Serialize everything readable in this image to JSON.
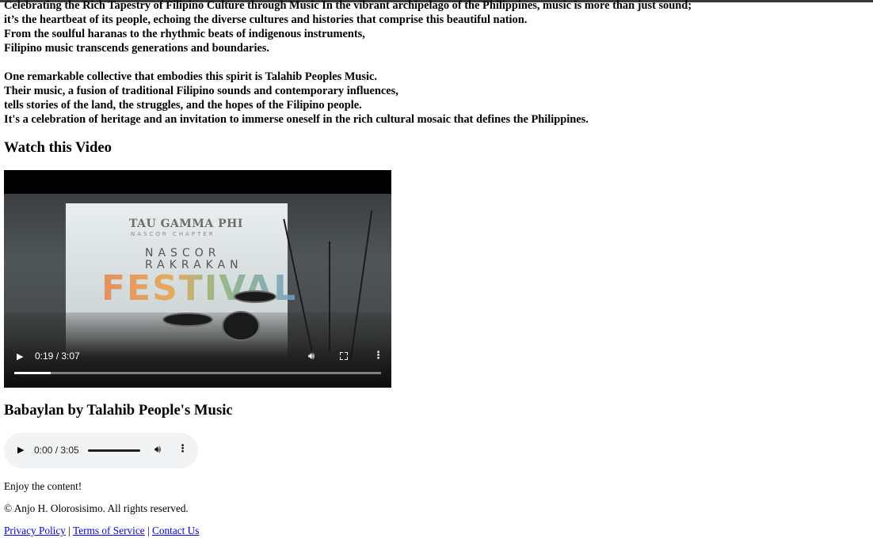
{
  "intro": {
    "lines": [
      "Celebrating the Rich Tapestry of Filipino Culture through Music In the vibrant archipelago of the Philippines, music is more than just sound;",
      "it’s the heartbeat of its people, echoing the diverse cultures and histories that comprise this beautiful nation.",
      "From the soulful haranas to the rhythmic beats of indigenous instruments,",
      "Filipino music transcends generations and boundaries.",
      "One remarkable collective that embodies this spirit is Talahib Peoples Music.",
      "Their music, a fusion of traditional Filipino sounds and contemporary influences,",
      "tells stories of the land, the struggles, and the hopes of the Filipino people.",
      "It's a celebration of heritage and an invitation to immerse oneself in the rich cultural mosaic that defines the Philippines."
    ]
  },
  "video_section": {
    "heading": "Watch this Video",
    "player": {
      "time_display": "0:19 / 3:07",
      "progress_fraction": 0.1,
      "frame_text": {
        "banner_line1": "TAU GAMMA PHI",
        "banner_line2": "NASCOR CHAPTER",
        "banner_line3a": "NASCOR",
        "banner_line3b": "RAKRAKAN",
        "banner_line4": "FESTIVAL"
      },
      "icons": {
        "play": "play-icon",
        "volume": "volume-icon",
        "fullscreen": "fullscreen-icon",
        "more": "more-options-icon"
      }
    }
  },
  "audio_section": {
    "heading": "Babaylan by Talahib People's Music",
    "player": {
      "time_display": "0:00 / 3:05",
      "icons": {
        "play": "play-icon",
        "volume": "volume-icon",
        "more": "more-options-icon"
      }
    }
  },
  "footer": {
    "message": "Enjoy the content!",
    "copyright": "© Anjo H. Olorosisimo. All rights reserved.",
    "links": {
      "privacy": "Privacy Policy",
      "terms": "Terms of Service",
      "contact": "Contact Us",
      "separator": "|"
    }
  },
  "colors": {
    "link": "#0000ee",
    "audio_bg": "#f1f3f4",
    "video_bg": "#000000"
  }
}
